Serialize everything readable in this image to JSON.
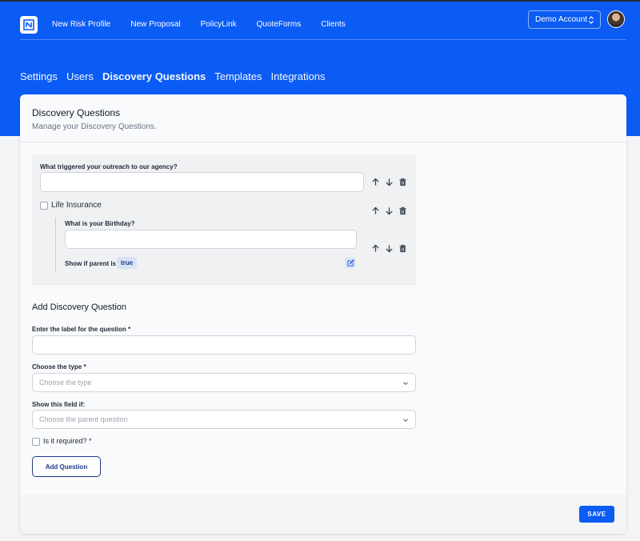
{
  "nav": {
    "links": [
      "New Risk Profile",
      "New Proposal",
      "PolicyLink",
      "QuoteForms",
      "Clients"
    ],
    "account": "Demo Account"
  },
  "tabs": [
    "Settings",
    "Users",
    "Discovery Questions",
    "Templates",
    "Integrations"
  ],
  "active_tab": "Discovery Questions",
  "card": {
    "title": "Discovery Questions",
    "subtitle": "Manage your Discovery Questions."
  },
  "questions": {
    "q1_label": "What triggered your outreach to our agency?",
    "q1_value": "",
    "q2_label": "Life Insurance",
    "q2_checked": false,
    "child_label": "What is your Birthday?",
    "child_value": "",
    "show_if_label": "Show if parent is",
    "show_if_value": "true"
  },
  "add_form": {
    "heading": "Add Discovery Question",
    "label_field": "Enter the label for the question *",
    "label_value": "",
    "type_field": "Choose the type *",
    "type_placeholder": "Choose the type",
    "show_field": "Show this field if:",
    "show_placeholder": "Choose the parent question",
    "required_label": "Is it required? *",
    "required_checked": false,
    "add_button": "Add Question"
  },
  "save_button": "SAVE",
  "colors": {
    "brand": "#0b5cf5",
    "accent_dark": "#1e3a8a"
  }
}
